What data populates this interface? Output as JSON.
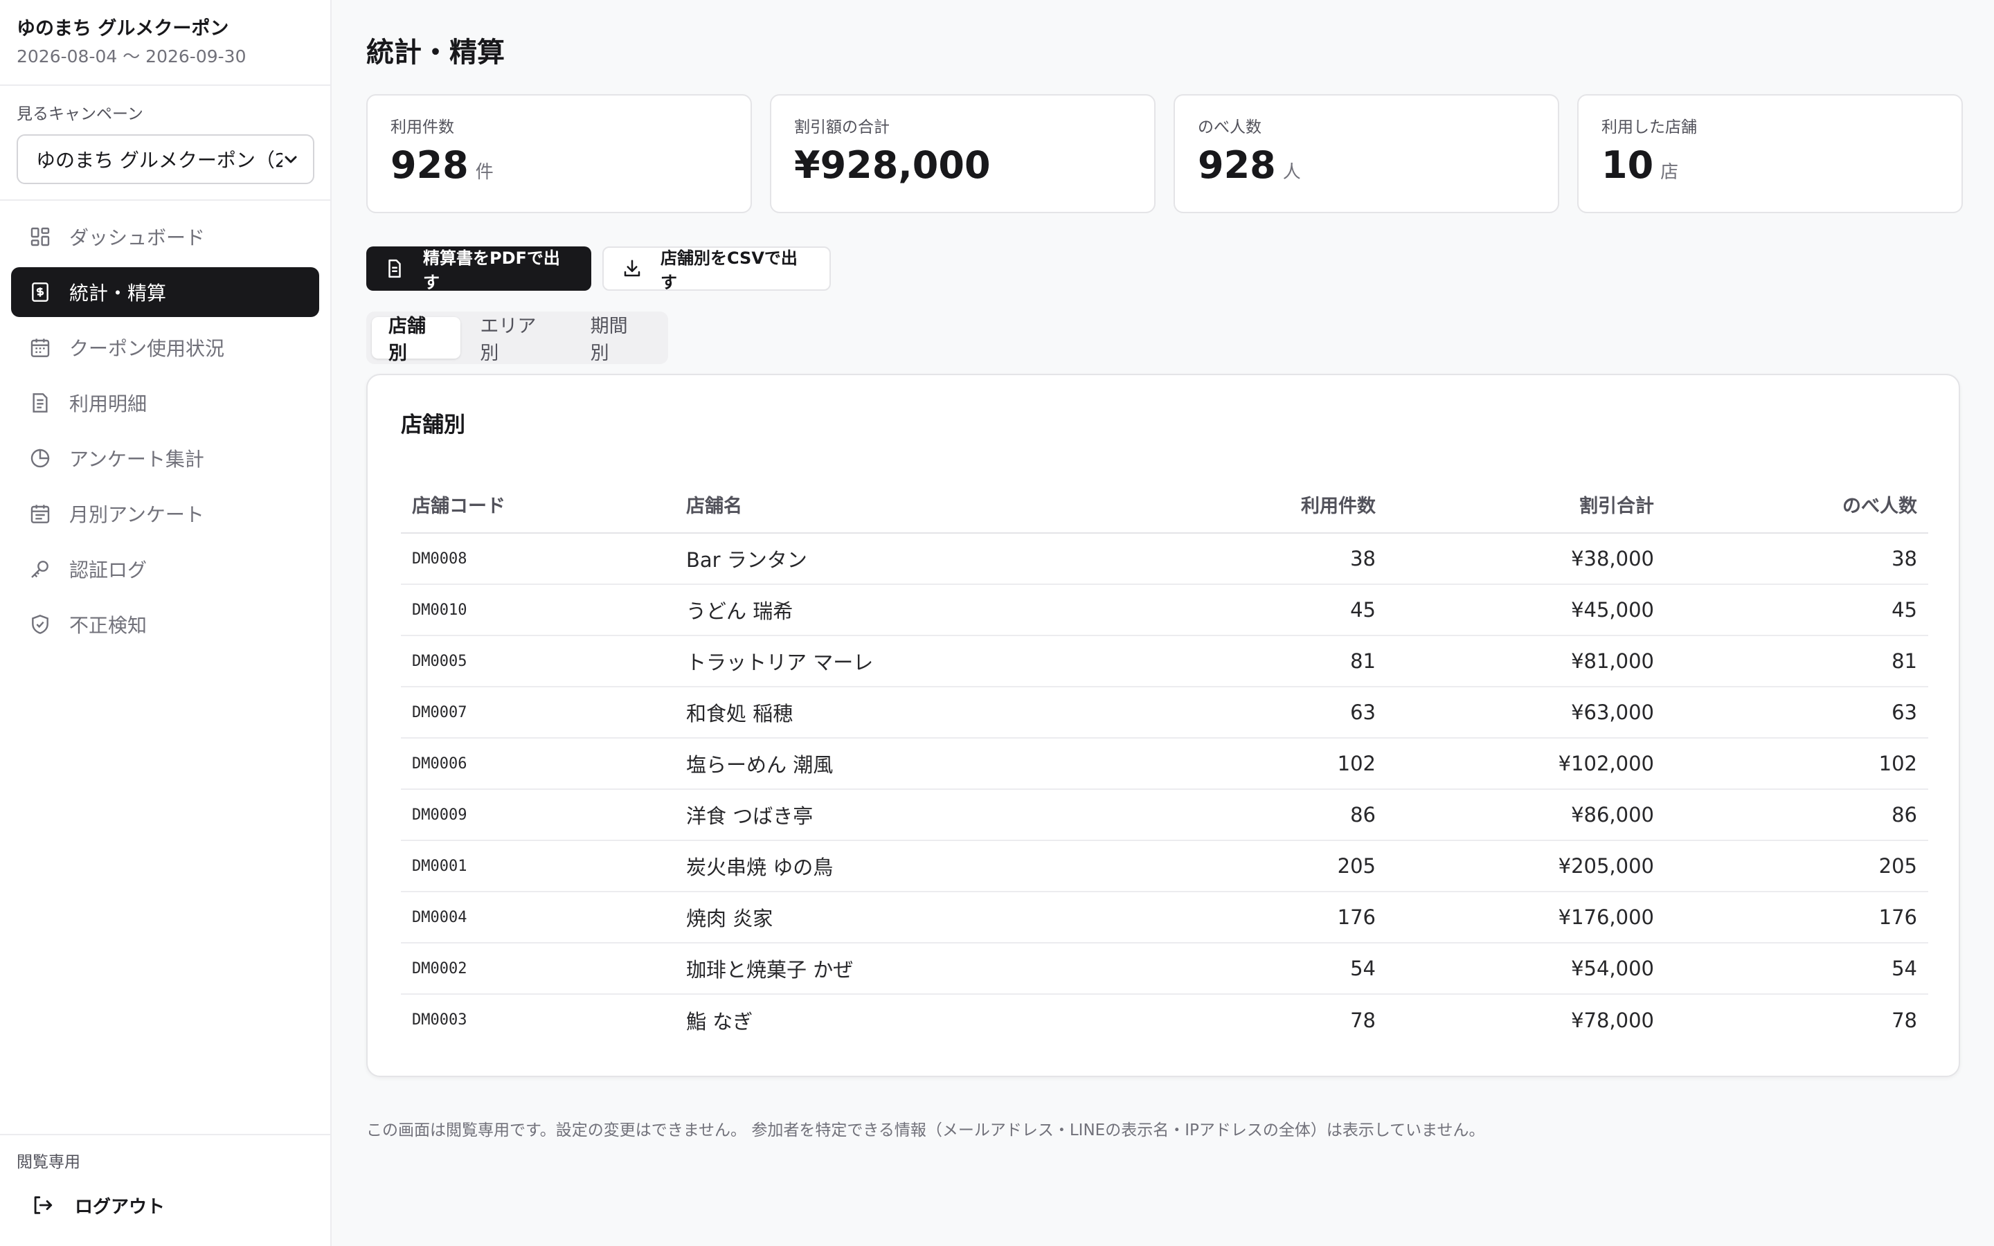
{
  "sidebar": {
    "app_title": "ゆのまち グルメクーポン",
    "period": "2026-08-04 〜 2026-09-30",
    "campaign_label": "見るキャンペーン",
    "campaign_selected": "ゆのまち グルメクーポン（2",
    "nav": [
      {
        "label": "ダッシュボード",
        "icon": "dashboard-icon",
        "active": false
      },
      {
        "label": "統計・精算",
        "icon": "receipt-icon",
        "active": true
      },
      {
        "label": "クーポン使用状況",
        "icon": "calendar-icon",
        "active": false
      },
      {
        "label": "利用明細",
        "icon": "document-icon",
        "active": false
      },
      {
        "label": "アンケート集計",
        "icon": "pie-chart-icon",
        "active": false
      },
      {
        "label": "月別アンケート",
        "icon": "calendar-list-icon",
        "active": false
      },
      {
        "label": "認証ログ",
        "icon": "key-icon",
        "active": false
      },
      {
        "label": "不正検知",
        "icon": "shield-icon",
        "active": false
      }
    ],
    "readonly_label": "閲覧専用",
    "logout_label": "ログアウト"
  },
  "main": {
    "page_title": "統計・精算",
    "stats": [
      {
        "label": "利用件数",
        "value": "928",
        "unit": "件"
      },
      {
        "label": "割引額の合計",
        "value": "¥928,000",
        "unit": ""
      },
      {
        "label": "のべ人数",
        "value": "928",
        "unit": "人"
      },
      {
        "label": "利用した店舗",
        "value": "10",
        "unit": "店"
      }
    ],
    "actions": {
      "pdf_label": "精算書をPDFで出す",
      "csv_label": "店舗別をCSVで出す"
    },
    "tabs": [
      {
        "label": "店舗別",
        "active": true
      },
      {
        "label": "エリア別",
        "active": false
      },
      {
        "label": "期間別",
        "active": false
      }
    ],
    "card_title": "店舗別",
    "table": {
      "headers": [
        "店舗コード",
        "店舗名",
        "利用件数",
        "割引合計",
        "のべ人数"
      ],
      "rows": [
        [
          "DM0008",
          "Bar ランタン",
          "38",
          "¥38,000",
          "38"
        ],
        [
          "DM0010",
          "うどん 瑞希",
          "45",
          "¥45,000",
          "45"
        ],
        [
          "DM0005",
          "トラットリア マーレ",
          "81",
          "¥81,000",
          "81"
        ],
        [
          "DM0007",
          "和食処 稲穂",
          "63",
          "¥63,000",
          "63"
        ],
        [
          "DM0006",
          "塩らーめん 潮風",
          "102",
          "¥102,000",
          "102"
        ],
        [
          "DM0009",
          "洋食 つばき亭",
          "86",
          "¥86,000",
          "86"
        ],
        [
          "DM0001",
          "炭火串焼 ゆの鳥",
          "205",
          "¥205,000",
          "205"
        ],
        [
          "DM0004",
          "焼肉 炎家",
          "176",
          "¥176,000",
          "176"
        ],
        [
          "DM0002",
          "珈琲と焼菓子 かぜ",
          "54",
          "¥54,000",
          "54"
        ],
        [
          "DM0003",
          "鮨 なぎ",
          "78",
          "¥78,000",
          "78"
        ]
      ]
    },
    "footnote": "この画面は閲覧専用です。設定の変更はできません。 参加者を特定できる情報（メールアドレス・LINEの表示名・IPアドレスの全体）は表示していません。"
  }
}
